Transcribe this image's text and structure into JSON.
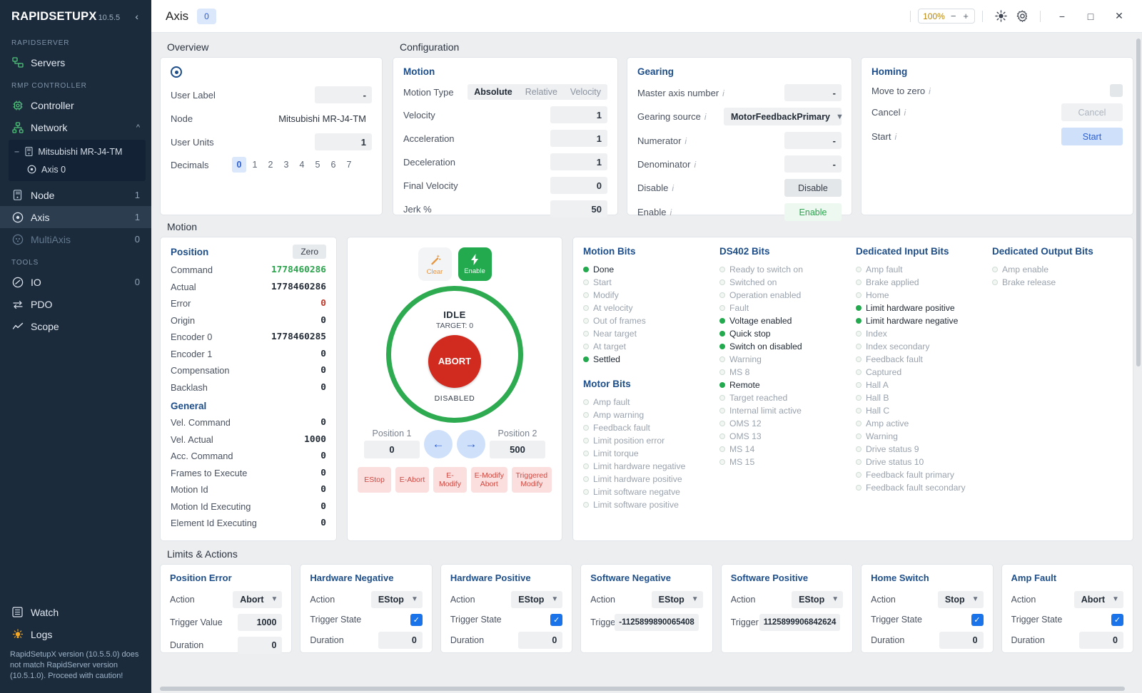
{
  "sidebar": {
    "brand": "RAPIDSETUPX",
    "version": "10.5.5",
    "collapse_icon": "‹",
    "sections": [
      {
        "label": "RAPIDSERVER",
        "items": [
          {
            "label": "Servers",
            "count": ""
          }
        ]
      },
      {
        "label": "RMP CONTROLLER",
        "items": [
          {
            "label": "Controller",
            "count": ""
          },
          {
            "label": "Network",
            "count": ""
          },
          {
            "label": "Node",
            "count": "1"
          },
          {
            "label": "Axis",
            "count": "1"
          },
          {
            "label": "MultiAxis",
            "count": "0"
          }
        ]
      },
      {
        "label": "TOOLS",
        "items": [
          {
            "label": "IO",
            "count": "0"
          },
          {
            "label": "PDO",
            "count": ""
          },
          {
            "label": "Scope",
            "count": ""
          }
        ]
      }
    ],
    "tree": {
      "parent": "Mitsubishi MR-J4-TM",
      "child": "Axis 0",
      "collapse_glyph": "−"
    },
    "bottom": [
      {
        "label": "Watch"
      },
      {
        "label": "Logs"
      }
    ],
    "warning": "RapidSetupX version (10.5.5.0) does not match RapidServer version (10.5.1.0). Proceed with caution!"
  },
  "topbar": {
    "title": "Axis",
    "axis_badge": "0",
    "zoom": "100%",
    "zoom_minus": "−",
    "zoom_plus": "+",
    "minimize": "−",
    "maximize": "□",
    "close": "✕"
  },
  "overview": {
    "section_title": "Overview",
    "rows": [
      {
        "label": "User Label",
        "value": "-",
        "type": "field"
      },
      {
        "label": "Node",
        "value": "Mitsubishi MR-J4-TM",
        "type": "plain"
      },
      {
        "label": "User Units",
        "value": "1",
        "type": "field"
      }
    ],
    "decimals_label": "Decimals",
    "decimals": [
      "0",
      "1",
      "2",
      "3",
      "4",
      "5",
      "6",
      "7"
    ],
    "decimals_selected": "0"
  },
  "configuration": {
    "section_title": "Configuration",
    "motion": {
      "title": "Motion",
      "motion_type_label": "Motion Type",
      "motion_types": [
        "Absolute",
        "Relative",
        "Velocity"
      ],
      "motion_type_selected": "Absolute",
      "rows": [
        {
          "label": "Velocity",
          "value": "1"
        },
        {
          "label": "Acceleration",
          "value": "1"
        },
        {
          "label": "Deceleration",
          "value": "1"
        },
        {
          "label": "Final Velocity",
          "value": "0"
        },
        {
          "label": "Jerk %",
          "value": "50"
        }
      ]
    },
    "gearing": {
      "title": "Gearing",
      "master_axis_label": "Master axis number",
      "master_axis_value": "-",
      "gearing_source_label": "Gearing source",
      "gearing_source_value": "MotorFeedbackPrimary",
      "numerator_label": "Numerator",
      "numerator_value": "-",
      "denominator_label": "Denominator",
      "denominator_value": "-",
      "disable_label": "Disable",
      "disable_button": "Disable",
      "enable_label": "Enable",
      "enable_button": "Enable"
    },
    "homing": {
      "title": "Homing",
      "move_to_zero_label": "Move to zero",
      "cancel_label": "Cancel",
      "cancel_button": "Cancel",
      "start_label": "Start",
      "start_button": "Start"
    }
  },
  "motion_section": {
    "section_title": "Motion",
    "position": {
      "title": "Position",
      "zero_button": "Zero",
      "rows": [
        {
          "label": "Command",
          "value": "1778460286",
          "color": "green"
        },
        {
          "label": "Actual",
          "value": "1778460286",
          "color": ""
        },
        {
          "label": "Error",
          "value": "0",
          "color": "red"
        },
        {
          "label": "Origin",
          "value": "0",
          "color": ""
        },
        {
          "label": "Encoder 0",
          "value": "1778460285",
          "color": ""
        },
        {
          "label": "Encoder 1",
          "value": "0",
          "color": ""
        },
        {
          "label": "Compensation",
          "value": "0",
          "color": ""
        },
        {
          "label": "Backlash",
          "value": "0",
          "color": ""
        }
      ],
      "general_title": "General",
      "general_rows": [
        {
          "label": "Vel. Command",
          "value": "0"
        },
        {
          "label": "Vel. Actual",
          "value": "1000"
        },
        {
          "label": "Acc. Command",
          "value": "0"
        },
        {
          "label": "Frames to Execute",
          "value": "0"
        },
        {
          "label": "Motion Id",
          "value": "0"
        },
        {
          "label": "Motion Id Executing",
          "value": "0"
        },
        {
          "label": "Element Id Executing",
          "value": "0"
        }
      ]
    },
    "control": {
      "clear_label": "Clear",
      "enable_label": "Enable",
      "state": "IDLE",
      "target": "TARGET: 0",
      "abort_label": "ABORT",
      "disabled_label": "DISABLED",
      "position1_label": "Position 1",
      "position1_value": "0",
      "position2_label": "Position 2",
      "position2_value": "500",
      "jog_left": "←",
      "jog_right": "→",
      "estop_buttons": [
        "EStop",
        "E-Abort",
        "E-Modify",
        "E-Modify Abort",
        "Triggered Modify"
      ]
    },
    "bits": {
      "motion_bits_title": "Motion Bits",
      "motion_bits": [
        {
          "label": "Done",
          "on": true
        },
        {
          "label": "Start",
          "on": false
        },
        {
          "label": "Modify",
          "on": false
        },
        {
          "label": "At velocity",
          "on": false
        },
        {
          "label": "Out of frames",
          "on": false
        },
        {
          "label": "Near target",
          "on": false
        },
        {
          "label": "At target",
          "on": false
        },
        {
          "label": "Settled",
          "on": true
        }
      ],
      "motor_bits_title": "Motor Bits",
      "motor_bits": [
        {
          "label": "Amp fault",
          "on": false
        },
        {
          "label": "Amp warning",
          "on": false
        },
        {
          "label": "Feedback fault",
          "on": false
        },
        {
          "label": "Limit position error",
          "on": false
        },
        {
          "label": "Limit torque",
          "on": false
        },
        {
          "label": "Limit hardware negative",
          "on": false
        },
        {
          "label": "Limit hardware positive",
          "on": false
        },
        {
          "label": "Limit software negatve",
          "on": false
        },
        {
          "label": "Limit software positive",
          "on": false
        }
      ],
      "ds402_title": "DS402 Bits",
      "ds402_bits": [
        {
          "label": "Ready to switch on",
          "on": false
        },
        {
          "label": "Switched on",
          "on": false
        },
        {
          "label": "Operation enabled",
          "on": false
        },
        {
          "label": "Fault",
          "on": false
        },
        {
          "label": "Voltage enabled",
          "on": true
        },
        {
          "label": "Quick stop",
          "on": true
        },
        {
          "label": "Switch on disabled",
          "on": true
        },
        {
          "label": "Warning",
          "on": false
        },
        {
          "label": "MS 8",
          "on": false
        },
        {
          "label": "Remote",
          "on": true
        },
        {
          "label": "Target reached",
          "on": false
        },
        {
          "label": "Internal limit active",
          "on": false
        },
        {
          "label": "OMS 12",
          "on": false
        },
        {
          "label": "OMS 13",
          "on": false
        },
        {
          "label": "MS 14",
          "on": false
        },
        {
          "label": "MS 15",
          "on": false
        }
      ],
      "dedicated_input_title": "Dedicated Input Bits",
      "dedicated_input_bits": [
        {
          "label": "Amp fault",
          "on": false
        },
        {
          "label": "Brake applied",
          "on": false
        },
        {
          "label": "Home",
          "on": false
        },
        {
          "label": "Limit hardware positive",
          "on": true
        },
        {
          "label": "Limit hardware negative",
          "on": true
        },
        {
          "label": "Index",
          "on": false
        },
        {
          "label": "Index secondary",
          "on": false
        },
        {
          "label": "Feedback fault",
          "on": false
        },
        {
          "label": "Captured",
          "on": false
        },
        {
          "label": "Hall A",
          "on": false
        },
        {
          "label": "Hall B",
          "on": false
        },
        {
          "label": "Hall C",
          "on": false
        },
        {
          "label": "Amp active",
          "on": false
        },
        {
          "label": "Warning",
          "on": false
        },
        {
          "label": "Drive status 9",
          "on": false
        },
        {
          "label": "Drive status 10",
          "on": false
        },
        {
          "label": "Feedback fault primary",
          "on": false
        },
        {
          "label": "Feedback fault secondary",
          "on": false
        }
      ],
      "dedicated_output_title": "Dedicated Output Bits",
      "dedicated_output_bits": [
        {
          "label": "Amp enable",
          "on": false
        },
        {
          "label": "Brake release",
          "on": false
        }
      ]
    }
  },
  "limits": {
    "section_title": "Limits & Actions",
    "action_label": "Action",
    "trigger_value_label": "Trigger Value",
    "trigger_state_label": "Trigger State",
    "duration_label": "Duration",
    "cards": [
      {
        "title": "Position Error",
        "action": "Abort",
        "trigger_value": "1000",
        "trigger_state": null,
        "duration": "0"
      },
      {
        "title": "Hardware Negative",
        "action": "EStop",
        "trigger_value": null,
        "trigger_state": true,
        "duration": "0"
      },
      {
        "title": "Hardware Positive",
        "action": "EStop",
        "trigger_value": null,
        "trigger_state": true,
        "duration": "0"
      },
      {
        "title": "Software Negative",
        "action": "EStop",
        "trigger_value": "-1125899890065408",
        "trigger_state": null,
        "duration": null
      },
      {
        "title": "Software Positive",
        "action": "EStop",
        "trigger_value": "1125899906842624",
        "trigger_state": null,
        "duration": null
      },
      {
        "title": "Home Switch",
        "action": "Stop",
        "trigger_value": null,
        "trigger_state": true,
        "duration": "0"
      },
      {
        "title": "Amp Fault",
        "action": "Abort",
        "trigger_value": null,
        "trigger_state": true,
        "duration": "0"
      }
    ]
  },
  "colors": {
    "accent_blue": "#2d5fd0",
    "green": "#23a94e",
    "red": "#d02b1e",
    "sidebar_bg": "#1b2b3c",
    "heading_blue": "#1d4e89"
  }
}
